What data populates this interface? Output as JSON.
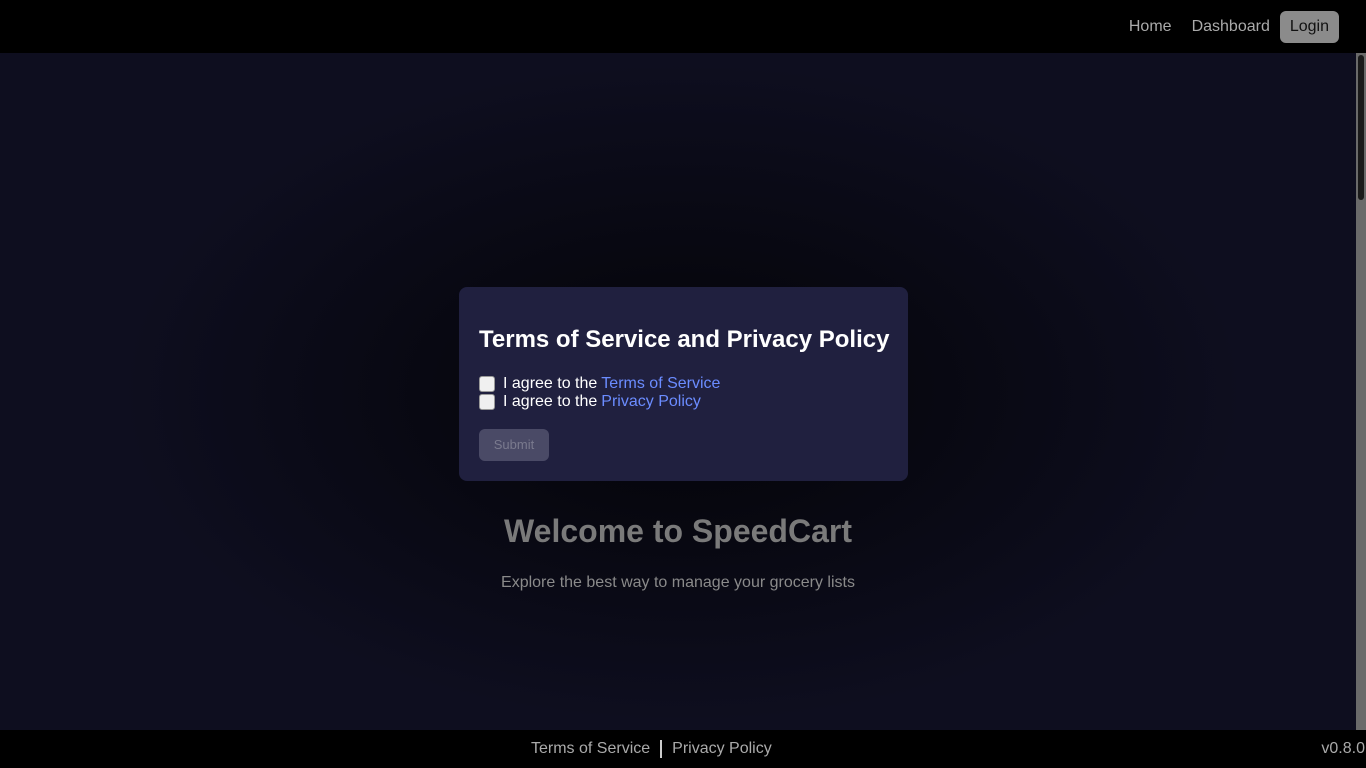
{
  "nav": {
    "items": [
      {
        "label": "Home",
        "active": false
      },
      {
        "label": "Dashboard",
        "active": false
      },
      {
        "label": "Login",
        "active": true
      }
    ]
  },
  "hero": {
    "title": "Welcome to SpeedCart",
    "subtitle": "Explore the best way to manage your grocery lists"
  },
  "modal": {
    "title": "Terms of Service and Privacy Policy",
    "checks": [
      {
        "prefix": "I agree to the",
        "link": "Terms of Service",
        "checked": false
      },
      {
        "prefix": "I agree to the",
        "link": "Privacy Policy",
        "checked": false
      }
    ],
    "submit_label": "Submit",
    "submit_disabled": true
  },
  "footer": {
    "links": [
      "Terms of Service",
      "Privacy Policy"
    ],
    "version": "v0.8.0"
  },
  "colors": {
    "modal_bg": "#20203f",
    "link": "#6b8cff",
    "active_nav_bg": "#8b8b8b"
  }
}
